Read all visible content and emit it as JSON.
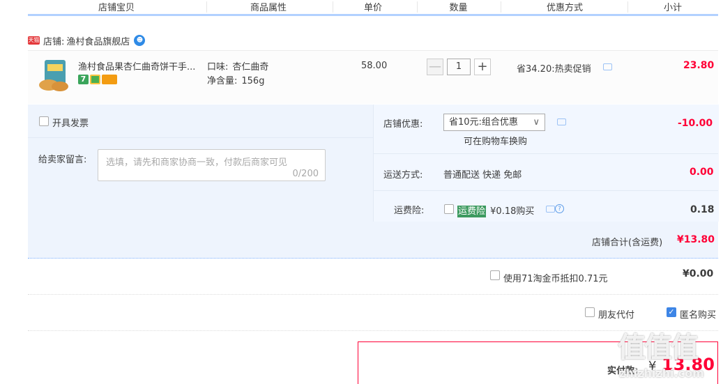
{
  "header": {
    "columns": [
      "店铺宝贝",
      "商品属性",
      "单价",
      "数量",
      "优惠方式",
      "小计"
    ]
  },
  "shop": {
    "badge": "天猫",
    "label": "店铺:",
    "name": "渔村食品旗舰店"
  },
  "item": {
    "title": "渔村食品果杏仁曲奇饼干手...",
    "attr_flavor_label": "口味:",
    "attr_flavor": "杏仁曲奇",
    "attr_weight_label": "净含量:",
    "attr_weight": "156g",
    "price": "58.00",
    "quantity": "1",
    "minus": "—",
    "plus": "+",
    "discount": "省34.20:热卖促销",
    "subtotal": "23.80",
    "badge_7": "7"
  },
  "invoice": {
    "label": "开具发票"
  },
  "message": {
    "label": "给卖家留言:",
    "placeholder": "选填，请先和商家协商一致，付款后商家可见",
    "counter": "0/200"
  },
  "shop_discount": {
    "label": "店铺优惠:",
    "selected": "省10元:组合优惠",
    "hint": "可在购物车换购",
    "amount": "-10.00"
  },
  "shipping": {
    "label": "运送方式:",
    "value": "普通配送 快递 免邮",
    "amount": "0.00"
  },
  "insurance": {
    "label": "运费险:",
    "tag": "运费险",
    "price_text": "¥0.18购买",
    "amount": "0.18"
  },
  "shop_total": {
    "label": "店铺合计(含运费)",
    "amount": "¥13.80"
  },
  "coins": {
    "label": "使用71淘金币抵扣0.71元",
    "amount": "¥0.00"
  },
  "options": {
    "friend_pay": "朋友代付",
    "anonymous": "匿名购买"
  },
  "payment": {
    "label": "实付款:",
    "currency": "¥",
    "amount": "13.80"
  },
  "watermark": {
    "text": "值值值",
    "sub": "zhizhizhi.com"
  },
  "colors": {
    "accent_red": "#ff0036",
    "accent_blue": "#3d85e6",
    "panel_bg": "#eef4fd"
  }
}
